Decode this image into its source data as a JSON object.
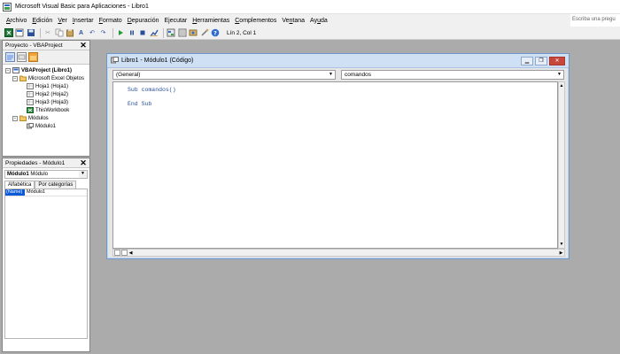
{
  "window": {
    "title": "Microsoft Visual Basic para Aplicaciones - Libro1"
  },
  "menu": {
    "items": [
      {
        "pre": "",
        "u": "A",
        "post": "rchivo"
      },
      {
        "pre": "",
        "u": "E",
        "post": "dición"
      },
      {
        "pre": "",
        "u": "V",
        "post": "er"
      },
      {
        "pre": "",
        "u": "I",
        "post": "nsertar"
      },
      {
        "pre": "",
        "u": "F",
        "post": "ormato"
      },
      {
        "pre": "",
        "u": "D",
        "post": "epuración"
      },
      {
        "pre": "E",
        "u": "j",
        "post": "ecutar"
      },
      {
        "pre": "",
        "u": "H",
        "post": "erramientas"
      },
      {
        "pre": "",
        "u": "C",
        "post": "omplementos"
      },
      {
        "pre": "Ve",
        "u": "n",
        "post": "tana"
      },
      {
        "pre": "Ay",
        "u": "u",
        "post": "da"
      }
    ],
    "ask_placeholder": "Escriba una pregu"
  },
  "toolbar": {
    "position": "Lín 2, Col 1"
  },
  "project": {
    "title": "Proyecto - VBAProject",
    "root": "VBAProject (Libro1)",
    "folder_excel": "Microsoft Excel Objetos",
    "sheet1": "Hoja1 (Hoja1)",
    "sheet2": "Hoja2 (Hoja2)",
    "sheet3": "Hoja3 (Hoja3)",
    "workbook": "ThisWorkbook",
    "folder_modules": "Módulos",
    "module1": "Módulo1"
  },
  "properties": {
    "title": "Propiedades - Módulo1",
    "object_name": "Módulo1",
    "object_type": "Módulo",
    "tab_alpha": "Alfabética",
    "tab_category": "Por categorías",
    "row_name": "(Name)",
    "row_value": "Módulo1"
  },
  "code_window": {
    "title": "Libro1 - Módulo1 (Código)",
    "object_combo": "(General)",
    "proc_combo": "comandos",
    "lines": [
      "Sub comandos()",
      "End Sub"
    ]
  },
  "colors": {
    "code_keyword": "#2a4f9a",
    "selection": "#0a58d6",
    "workspace": "#ababab"
  }
}
